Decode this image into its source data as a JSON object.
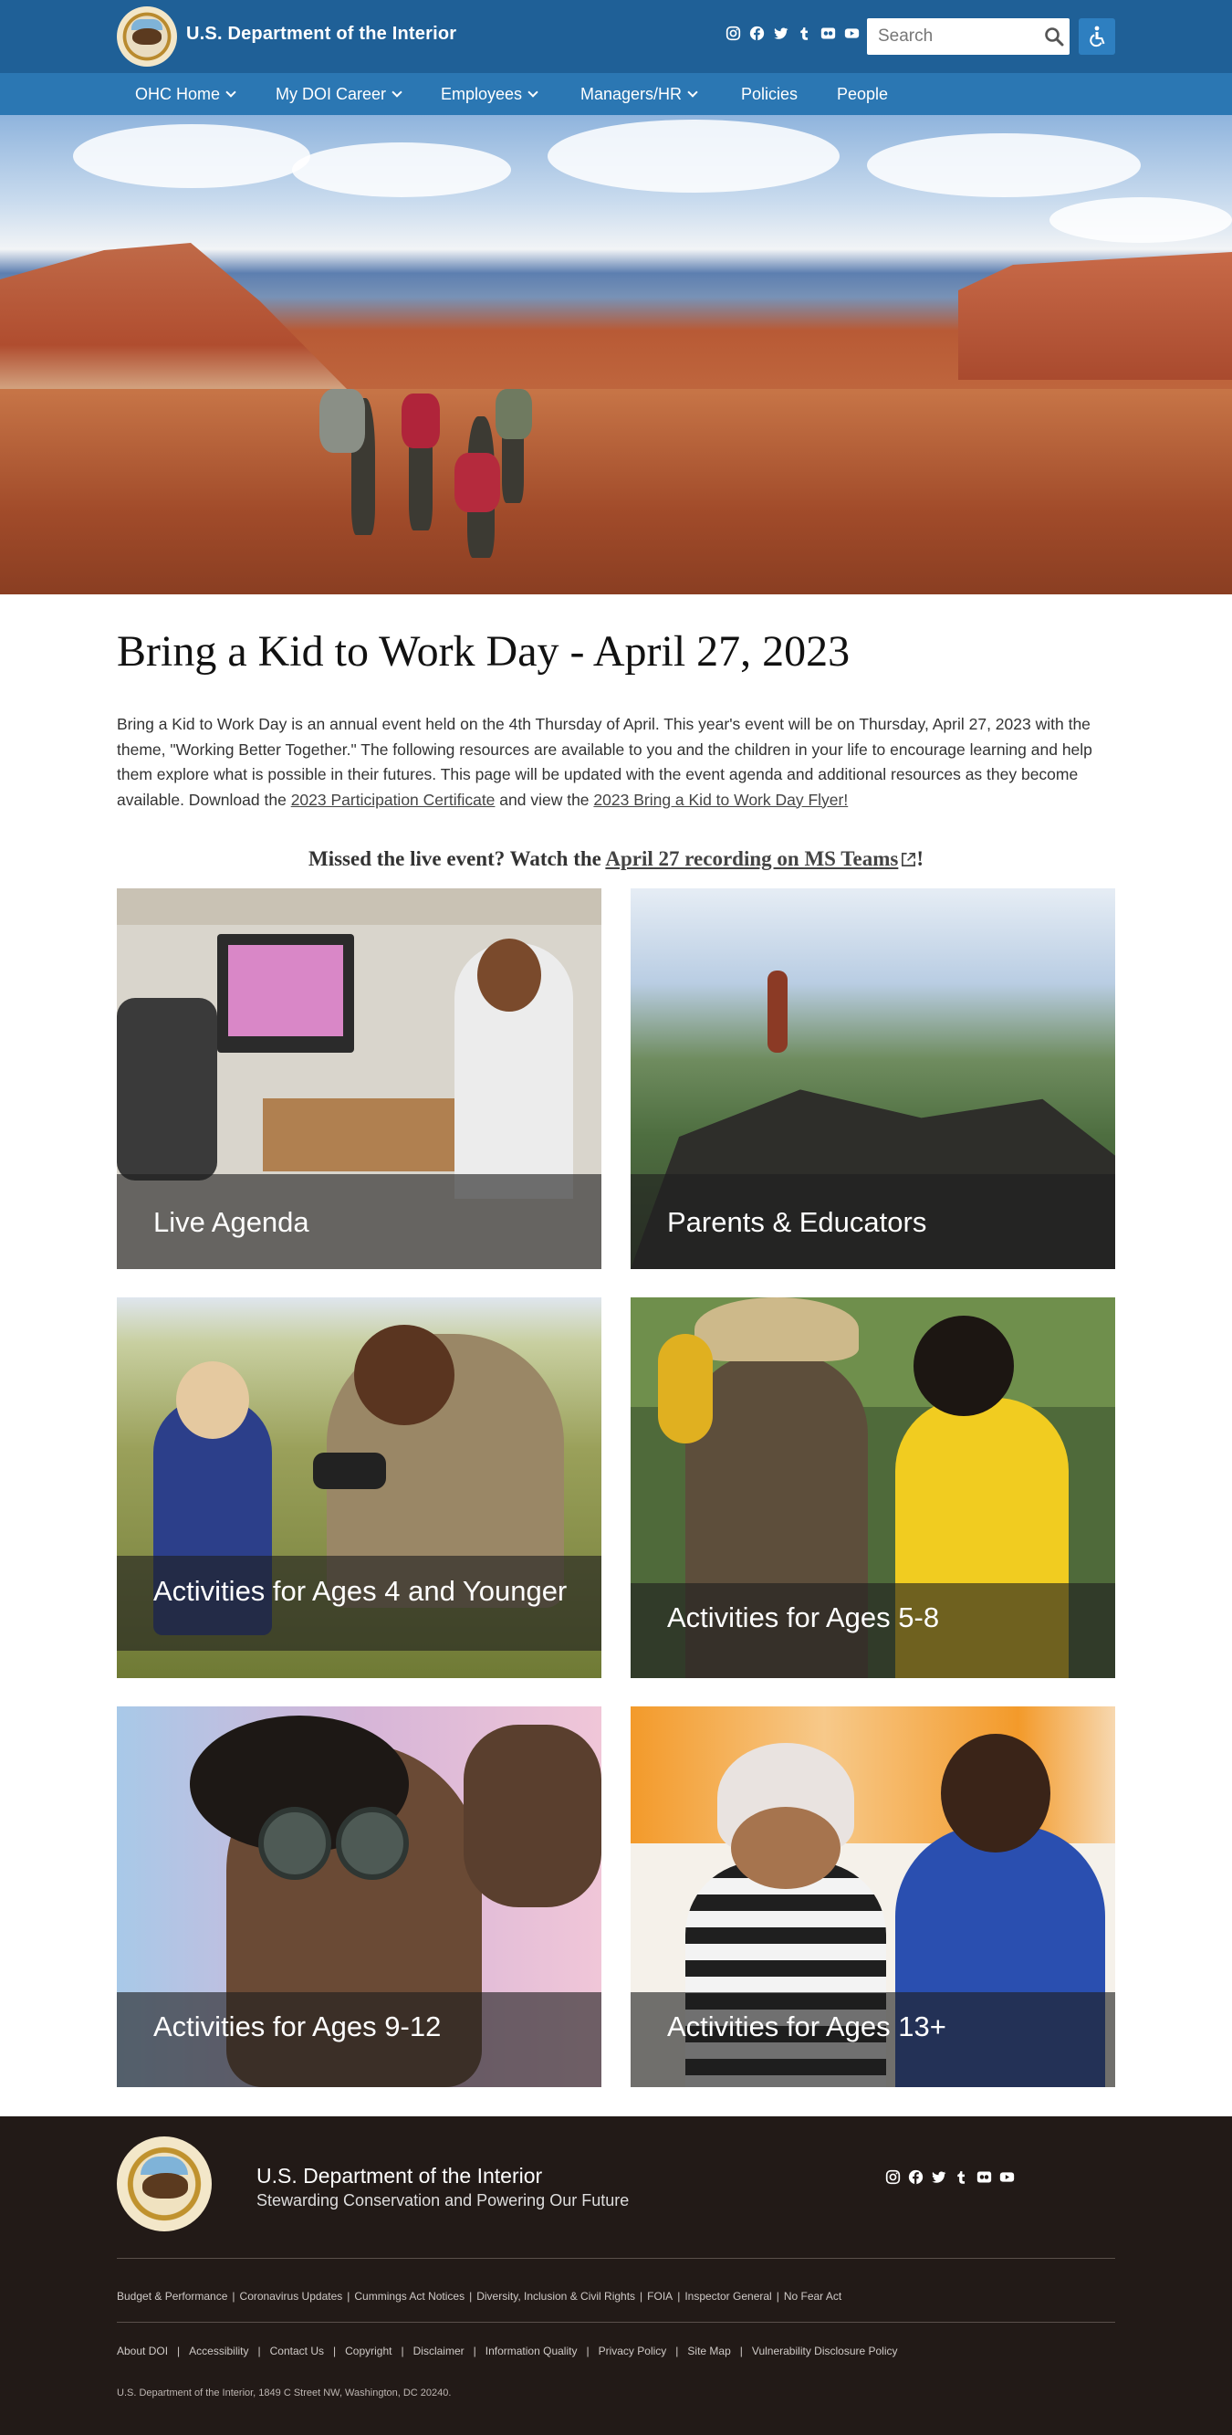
{
  "header": {
    "site_title": "U.S. Department of the Interior",
    "social": [
      "instagram-icon",
      "facebook-icon",
      "twitter-icon",
      "tumblr-icon",
      "flickr-icon",
      "youtube-icon"
    ],
    "search": {
      "placeholder": "Search"
    }
  },
  "nav": {
    "items": [
      {
        "label": "OHC Home"
      },
      {
        "label": "My DOI Career"
      },
      {
        "label": "Employees"
      },
      {
        "label": "Managers/HR"
      },
      {
        "label": "Policies"
      },
      {
        "label": "People"
      }
    ]
  },
  "main": {
    "title": "Bring a Kid to Work Day - April 27, 2023",
    "intro_text": "Bring a Kid to Work Day is an annual event held on the 4th Thursday of April. This year's event will be on Thursday, April 27, 2023 with the theme, \"Working Better Together.\" The following resources are available to you and the children in your life to encourage learning and help them explore what is possible in their futures. This page will be updated with the event agenda and additional resources as they become available. Download the ",
    "certificate_link": "2023 Participation Certificate",
    "intro_mid": " and view the ",
    "flyer_link": "2023 Bring a Kid to Work Day Flyer!",
    "missed_prefix": "Missed the live event? Watch the ",
    "recording_link": "April 27 recording on MS Teams",
    "missed_suffix": "!",
    "tiles": [
      {
        "label": "Live Agenda"
      },
      {
        "label": "Parents & Educators"
      },
      {
        "label": "Activities for Ages 4 and Younger"
      },
      {
        "label": "Activities for Ages 5-8"
      },
      {
        "label": "Activities for Ages 9-12"
      },
      {
        "label": "Activities for Ages 13+"
      }
    ]
  },
  "footer": {
    "title": "U.S. Department of the Interior",
    "subtitle": "Stewarding Conservation and Powering Our Future",
    "links_row1": [
      "Budget & Performance",
      "Coronavirus Updates",
      "Cummings Act Notices",
      "Diversity, Inclusion & Civil Rights",
      "FOIA",
      "Inspector General",
      "No Fear Act"
    ],
    "links_row2": [
      "About DOI",
      "Accessibility",
      "Contact Us",
      "Copyright",
      "Disclaimer",
      "Information Quality",
      "Privacy Policy",
      "Site Map",
      "Vulnerability Disclosure Policy"
    ],
    "address": "U.S. Department of the Interior, 1849 C Street NW, Washington, DC 20240."
  },
  "colors": {
    "header_bg": "#1f6097",
    "nav_bg": "#2b77b3",
    "footer_bg": "#221a17",
    "accessibility_button": "#2e7fc0"
  }
}
